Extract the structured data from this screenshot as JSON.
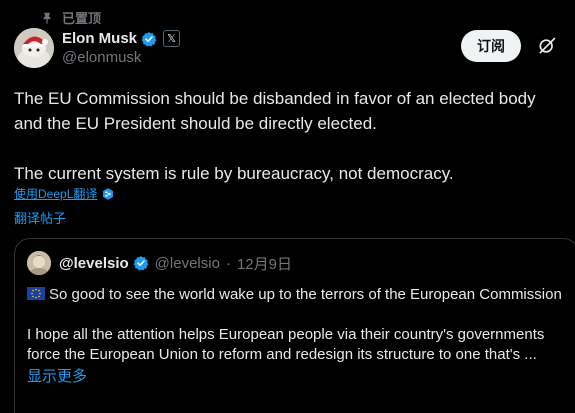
{
  "pinned": {
    "label": "已置顶"
  },
  "author": {
    "name": "Elon Musk",
    "handle": "@elonmusk",
    "x_badge": "𝕏"
  },
  "subscribe_label": "订阅",
  "body": {
    "paragraph_1": "The EU Commission should be disbanded in favor of an elected body and the EU President should be directly elected.",
    "paragraph_2": "The current system is rule by bureaucracy, not democracy."
  },
  "deepl_label": "使用DeepL翻译",
  "translate_label": "翻译帖子",
  "quote": {
    "name": "@levelsio",
    "handle": "@levelsio",
    "separator": "·",
    "date": "12月9日",
    "paragraph_1": "So good to see the world wake up to the terrors of the European Commission",
    "paragraph_2": "I hope all the attention helps European people via their country's governments force the European Union to reform and redesign its structure to one that's ...",
    "show_more": "显示更多"
  },
  "icons": {
    "pin": "pin-icon",
    "verified": "verified-badge-icon",
    "grok": "grok-icon",
    "deepl": "deepl-icon",
    "flag": "eu-flag-icon"
  },
  "colors": {
    "background": "#000000",
    "text": "#e7e9ea",
    "muted": "#71767b",
    "link": "#1d9bf0",
    "verified": "#1d9bf0",
    "border": "#2f3336",
    "button_bg": "#eff3f4"
  }
}
